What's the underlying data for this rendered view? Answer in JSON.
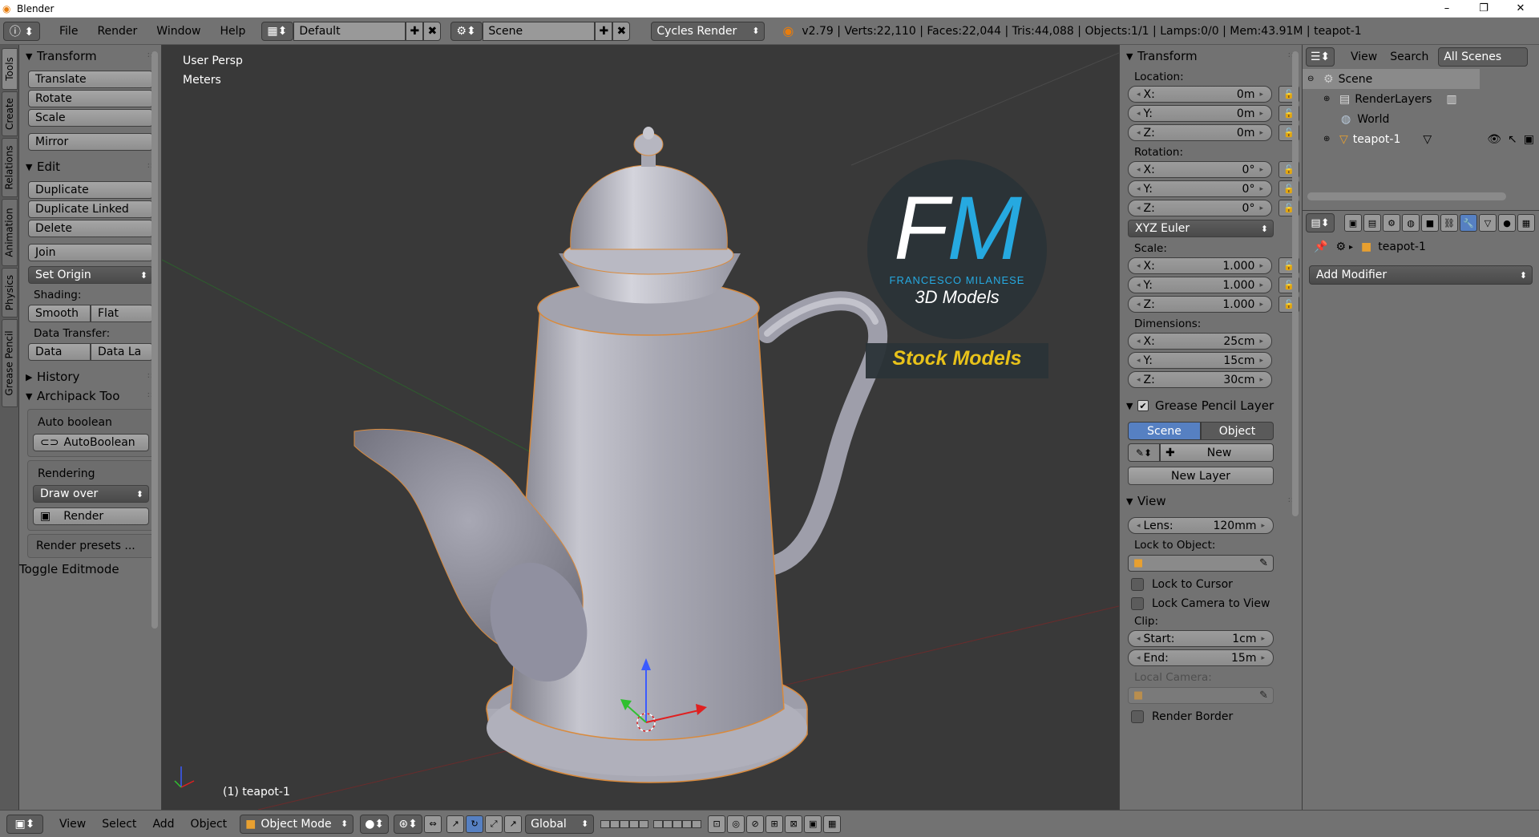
{
  "window": {
    "title": "Blender",
    "controls": [
      "–",
      "❐",
      "✕"
    ]
  },
  "info": {
    "menus": [
      "File",
      "Render",
      "Window",
      "Help"
    ],
    "layout": "Default",
    "scene": "Scene",
    "engine": "Cycles Render",
    "stats": "v2.79 | Verts:22,110 | Faces:22,044 | Tris:44,088 | Objects:1/1 | Lamps:0/0 | Mem:43.91M | teapot-1"
  },
  "tabs": [
    "Tools",
    "Create",
    "Relations",
    "Animation",
    "Physics",
    "Grease Pencil"
  ],
  "toolshelf": {
    "transform": {
      "title": "Transform",
      "buttons": [
        "Translate",
        "Rotate",
        "Scale"
      ],
      "mirror": "Mirror"
    },
    "edit": {
      "title": "Edit",
      "buttons": [
        "Duplicate",
        "Duplicate Linked",
        "Delete"
      ],
      "join": "Join",
      "set_origin": "Set Origin",
      "shading_label": "Shading:",
      "smooth": "Smooth",
      "flat": "Flat",
      "transfer_label": "Data Transfer:",
      "data": "Data",
      "data_la": "Data La"
    },
    "history": "History",
    "archipack": {
      "title": "Archipack Too",
      "auto_boolean": "Auto boolean",
      "autoboolean_btn": "AutoBoolean",
      "rendering": "Rendering",
      "draw_over": "Draw over",
      "render_btn": "Render",
      "render_presets": "Render presets ..."
    },
    "toggle_editmode": "Toggle Editmode"
  },
  "viewport": {
    "view_name": "User Persp",
    "units": "Meters",
    "object_label": "(1) teapot-1",
    "watermark": {
      "letters": "FM",
      "name": "FRANCESCO MILANESE",
      "sub": "3D Models",
      "banner": "Stock Models"
    }
  },
  "npanel": {
    "transform_title": "Transform",
    "location_label": "Location:",
    "location": [
      {
        "axis": "X:",
        "value": "0m"
      },
      {
        "axis": "Y:",
        "value": "0m"
      },
      {
        "axis": "Z:",
        "value": "0m"
      }
    ],
    "rotation_label": "Rotation:",
    "rotation": [
      {
        "axis": "X:",
        "value": "0°"
      },
      {
        "axis": "Y:",
        "value": "0°"
      },
      {
        "axis": "Z:",
        "value": "0°"
      }
    ],
    "rotation_mode": "XYZ Euler",
    "scale_label": "Scale:",
    "scale": [
      {
        "axis": "X:",
        "value": "1.000"
      },
      {
        "axis": "Y:",
        "value": "1.000"
      },
      {
        "axis": "Z:",
        "value": "1.000"
      }
    ],
    "dimensions_label": "Dimensions:",
    "dimensions": [
      {
        "axis": "X:",
        "value": "25cm"
      },
      {
        "axis": "Y:",
        "value": "15cm"
      },
      {
        "axis": "Z:",
        "value": "30cm"
      }
    ],
    "gp_title": "Grease Pencil Layer",
    "gp_scene": "Scene",
    "gp_object": "Object",
    "gp_new": "New",
    "gp_new_layer": "New Layer",
    "view_title": "View",
    "lens_label": "Lens:",
    "lens_value": "120mm",
    "lock_object_label": "Lock to Object:",
    "lock_cursor": "Lock to Cursor",
    "lock_camera": "Lock Camera to View",
    "clip_label": "Clip:",
    "clip_start_label": "Start:",
    "clip_start": "1cm",
    "clip_end_label": "End:",
    "clip_end": "15m",
    "local_camera": "Local Camera:",
    "render_border": "Render Border"
  },
  "outliner": {
    "menus": [
      "View",
      "Search"
    ],
    "filter": "All Scenes",
    "items": [
      "Scene",
      "RenderLayers",
      "World",
      "teapot-1"
    ]
  },
  "properties": {
    "object": "teapot-1",
    "add_modifier": "Add Modifier"
  },
  "bottombar": {
    "menus": [
      "View",
      "Select",
      "Add",
      "Object"
    ],
    "mode": "Object Mode",
    "orientation": "Global"
  },
  "colors": {
    "viewport_bg": "#393939",
    "panel_bg": "#727272",
    "accent": "#5680c2",
    "teapot": "#9a9aa8",
    "stock_text": "#e8c21a",
    "fm_blue": "#26a9e0"
  }
}
